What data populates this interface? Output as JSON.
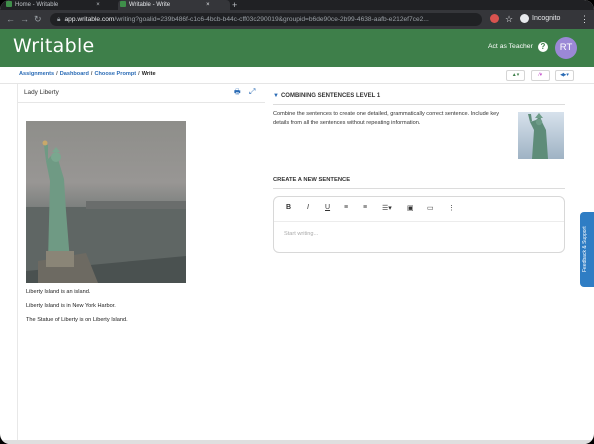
{
  "browser": {
    "tabs": [
      {
        "label": "Home - Writable",
        "close": "×"
      },
      {
        "label": "Writable - Write",
        "close": "×"
      }
    ],
    "new_tab": "+",
    "url_host": "app.writable.com",
    "url_path": "/writing?goalid=239b486f-c1c6-4bcb-b44c-cff03c290019&groupid=b6de90ce-2b99-4638-aafb-e212ef7ce2...",
    "incognito_label": "Incognito"
  },
  "app": {
    "logo": "Writable",
    "act_as": "Act as Teacher",
    "help": "?",
    "avatar": "RT",
    "brand_color": "#3e7f4a"
  },
  "breadcrumb": {
    "items": [
      "Assignments",
      "Dashboard",
      "Choose Prompt"
    ],
    "separator": "/",
    "current": "Write"
  },
  "toolbar_right": {
    "b1": "▲▾",
    "b2": "⁄▾",
    "b3": "◀▸▾"
  },
  "left_panel": {
    "title": "Lady Liberty",
    "paragraphs": [
      "Liberty Island is an island.",
      "Liberty Island is in New York Harbor.",
      "The Statue of Liberty is on Liberty Island."
    ]
  },
  "right_panel": {
    "section_title": "COMBINING SENTENCES LEVEL 1",
    "instructions": "Combine the sentences to create one detailed, grammatically correct sentence. Include key details from all the sentences without repeating information.",
    "create_heading": "CREATE A NEW SENTENCE",
    "editor_tools": [
      "B",
      "I",
      "U",
      "≡",
      "≡",
      "☰▾",
      "▣",
      "▭",
      "⋮"
    ],
    "placeholder": "Start writing..."
  },
  "side_tab": "Feedback & Support"
}
